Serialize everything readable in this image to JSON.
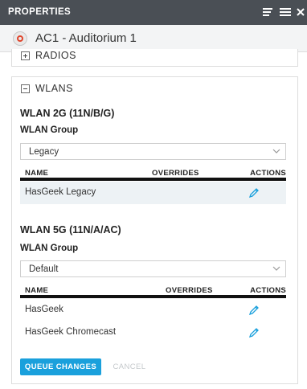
{
  "panel": {
    "title": "PROPERTIES"
  },
  "device": {
    "name": "AC1 - Auditorium 1",
    "status_color": "#e0452c"
  },
  "sections": {
    "radios": {
      "label": "RADIOS",
      "expanded": false
    },
    "wlans": {
      "label": "WLANS",
      "expanded": true
    }
  },
  "wlan_2g": {
    "heading": "WLAN 2G (11N/B/G)",
    "group_label": "WLAN Group",
    "selected_group": "Legacy",
    "columns": [
      "NAME",
      "OVERRIDES",
      "ACTIONS"
    ],
    "rows": [
      {
        "name": "HasGeek Legacy"
      }
    ]
  },
  "wlan_5g": {
    "heading": "WLAN 5G (11N/A/AC)",
    "group_label": "WLAN Group",
    "selected_group": "Default",
    "columns": [
      "NAME",
      "OVERRIDES",
      "ACTIONS"
    ],
    "rows": [
      {
        "name": "HasGeek"
      },
      {
        "name": "HasGeek Chromecast"
      }
    ]
  },
  "buttons": {
    "queue": "QUEUE CHANGES",
    "cancel": "CANCEL"
  },
  "colors": {
    "accent": "#1aa0dc",
    "header_bg": "#4a4f55",
    "edit_icon": "#1aa0dc"
  }
}
